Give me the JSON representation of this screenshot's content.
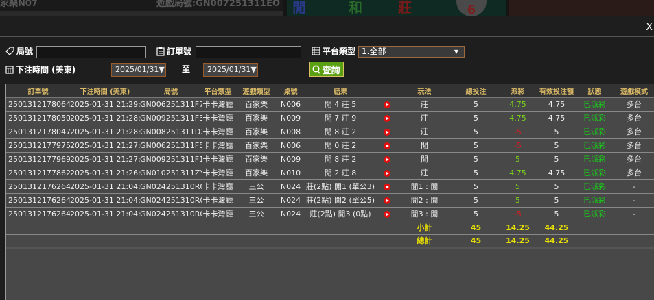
{
  "background": {
    "left_text": "家樂N07",
    "game_no": "遊戲局號:GN007251311EO",
    "board": [
      "閒",
      "和",
      "莊"
    ],
    "ball": "6"
  },
  "modal": {
    "close_label": "X"
  },
  "filters": {
    "round_label": "局號",
    "round_value": "",
    "order_label": "訂單號",
    "order_value": "",
    "platform_label": "平台類型",
    "platform_selected": "1.全部",
    "time_label": "下注時間 (美東)",
    "date_from": "2025/01/31▼",
    "to_label": "至",
    "date_to": "2025/01/31▼",
    "query_label": "查詢"
  },
  "colors": {
    "accent_green": "#5aa012",
    "header_gold": "#d8b866",
    "win_green": "#7ad41a",
    "loss_red": "#d02020",
    "status_green": "#19c919",
    "total_yellow": "#e8e000"
  },
  "table": {
    "headers": [
      "訂單號",
      "下注時間 (美東)",
      "局號",
      "平台類型",
      "遊戲類型",
      "桌號",
      "結果",
      "",
      "玩法",
      "總投注",
      "派彩",
      "有效投注額",
      "狀態",
      "遊戲模式"
    ],
    "rows": [
      [
        "250131217806425",
        "2025-01-31 21:29:12",
        "GN006251311F7",
        "卡卡灣廳",
        "百家樂",
        "N006",
        "閒 4 莊 5",
        "play-icon",
        "莊",
        "5",
        "4.75",
        "4.75",
        "已派彩",
        "多台"
      ],
      [
        "250131217805096",
        "2025-01-31 21:28:58",
        "GN009251311F3",
        "卡卡灣廳",
        "百家樂",
        "N009",
        "閒 7 莊 9",
        "play-icon",
        "莊",
        "5",
        "4.75",
        "4.75",
        "已派彩",
        "多台"
      ],
      [
        "250131217804723",
        "2025-01-31 21:28:55",
        "GN008251311DX",
        "卡卡灣廳",
        "百家樂",
        "N008",
        "閒 8 莊 2",
        "play-icon",
        "莊",
        "5",
        "-5",
        "5",
        "已派彩",
        "多台"
      ],
      [
        "250131217797520",
        "2025-01-31 21:27:47",
        "GN006251311F5",
        "卡卡灣廳",
        "百家樂",
        "N006",
        "閒 0 莊 2",
        "play-icon",
        "閒",
        "5",
        "-5",
        "5",
        "已派彩",
        "多台"
      ],
      [
        "250131217796962",
        "2025-01-31 21:27:43",
        "GN009251311F1",
        "卡卡灣廳",
        "百家樂",
        "N009",
        "閒 8 莊 2",
        "play-icon",
        "閒",
        "5",
        "5",
        "5",
        "已派彩",
        "多台"
      ],
      [
        "250131217786278",
        "2025-01-31 21:26:14",
        "GN010251311ZY",
        "卡卡灣廳",
        "百家樂",
        "N010",
        "閒 2 莊 8",
        "play-icon",
        "莊",
        "5",
        "4.75",
        "4.75",
        "已派彩",
        "多台"
      ],
      [
        "250131217626474",
        "2025-01-31 21:04:23",
        "GN024251310R0",
        "卡卡灣廳",
        "三公",
        "N024",
        "莊(2點) 閒1 (單公3)",
        "play-icon",
        "閒1 : 閒",
        "5",
        "5",
        "5",
        "已派彩",
        "-"
      ],
      [
        "250131217626473",
        "2025-01-31 21:04:23",
        "GN024251310R0",
        "卡卡灣廳",
        "三公",
        "N024",
        "莊(2點) 閒2 (單公5)",
        "play-icon",
        "閒2 : 閒",
        "5",
        "5",
        "5",
        "已派彩",
        "-"
      ],
      [
        "250131217626472",
        "2025-01-31 21:04:23",
        "GN024251310R0",
        "卡卡灣廳",
        "三公",
        "N024",
        "莊(2點) 閒3 (0點)",
        "play-icon",
        "閒3 : 閒",
        "5",
        "-5",
        "5",
        "已派彩",
        "-"
      ]
    ],
    "subtotal": {
      "label": "小計",
      "total_bet": "45",
      "payout": "14.25",
      "valid_bet": "44.25"
    },
    "grand_total": {
      "label": "總計",
      "total_bet": "45",
      "payout": "14.25",
      "valid_bet": "44.25"
    }
  }
}
